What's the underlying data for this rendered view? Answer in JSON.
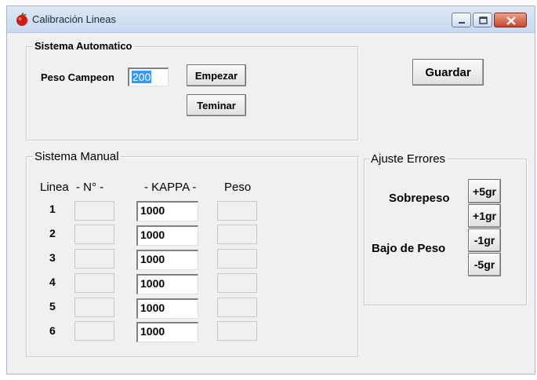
{
  "window": {
    "title": "Calibración Lineas"
  },
  "icons": {
    "app": "apple-icon",
    "min": "minimize-icon",
    "max": "maximize-icon",
    "close": "close-icon"
  },
  "auto": {
    "legend": "Sistema Automatico",
    "peso_label": "Peso Campeon",
    "peso_value": "200",
    "start_label": "Empezar",
    "stop_label": "Teminar"
  },
  "save_label": "Guardar",
  "manual": {
    "legend": "Sistema Manual",
    "headers": {
      "linea": "Linea",
      "numero": "- N° -",
      "kappa": "- KAPPA -",
      "peso": "Peso"
    },
    "rows": [
      {
        "line": "1",
        "kappa": "1000"
      },
      {
        "line": "2",
        "kappa": "1000"
      },
      {
        "line": "3",
        "kappa": "1000"
      },
      {
        "line": "4",
        "kappa": "1000"
      },
      {
        "line": "5",
        "kappa": "1000"
      },
      {
        "line": "6",
        "kappa": "1000"
      }
    ]
  },
  "errors": {
    "legend": "Ajuste Errores",
    "sobrepeso": "Sobrepeso",
    "bajo": "Bajo de Peso",
    "plus5": "+5gr",
    "plus1": "+1gr",
    "minus1": "-1gr",
    "minus5": "-5gr"
  }
}
